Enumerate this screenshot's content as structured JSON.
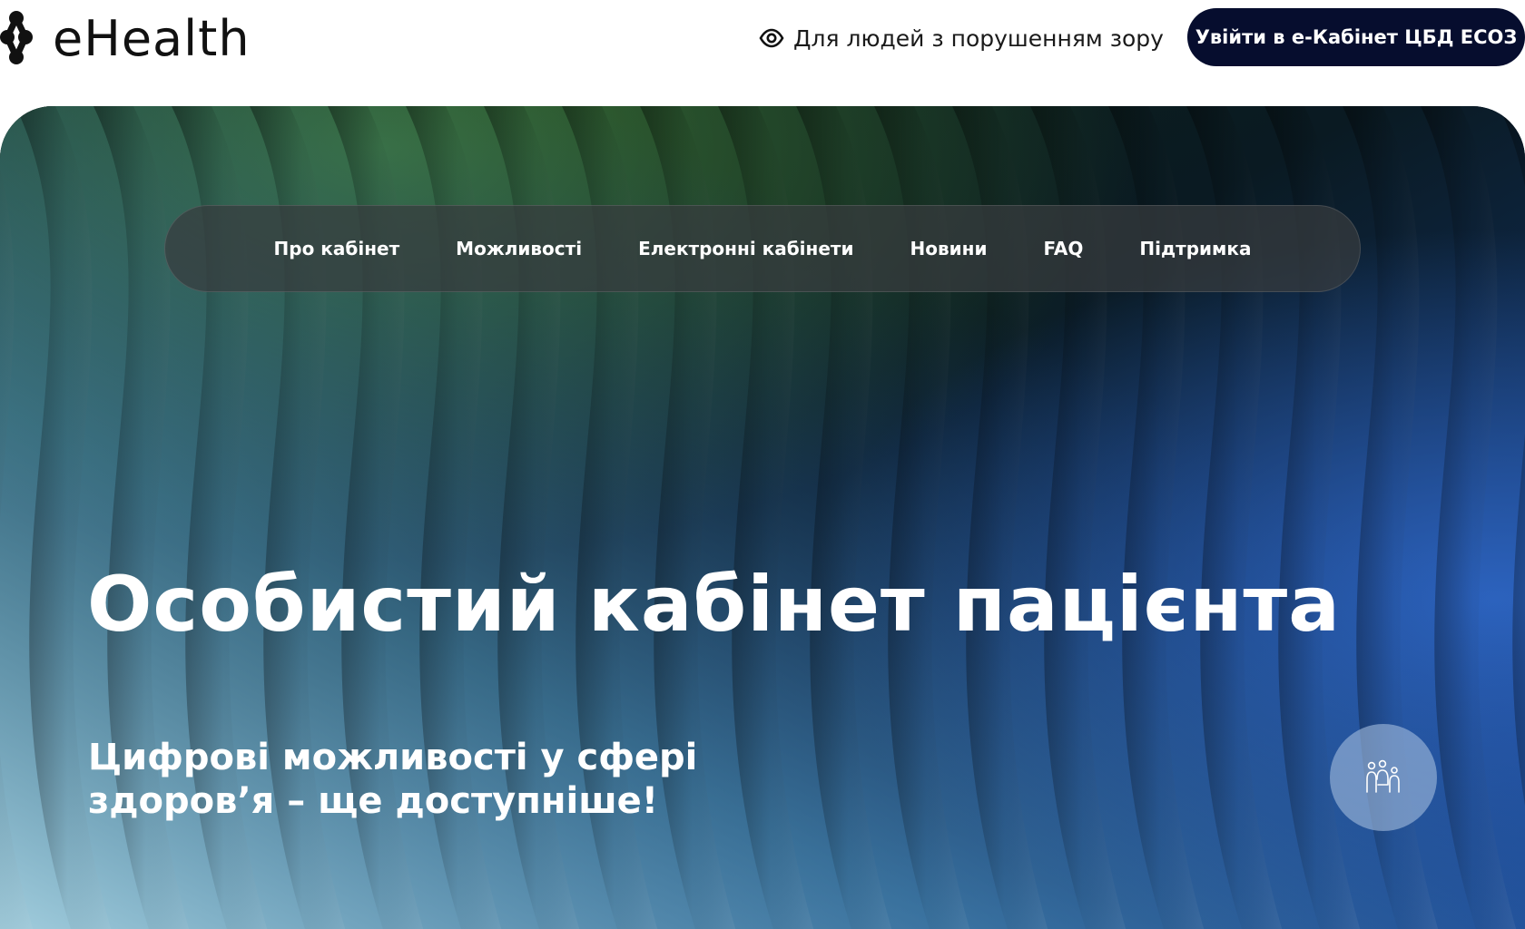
{
  "header": {
    "logo_text": "eHealth",
    "vision_link": "Для людей з порушенням зору",
    "login_button": "Увійти в е-Кабінет ЦБД ЕСОЗ"
  },
  "nav": {
    "items": [
      "Про кабінет",
      "Можливості",
      "Електронні кабінети",
      "Новини",
      "FAQ",
      "Підтримка"
    ]
  },
  "hero": {
    "title": "Особистий кабінет пацієнта",
    "subtitle": "Цифрові можливості у сфері здоров’я – ще доступніше!"
  },
  "icons": {
    "logo": "ehealth-logo-icon",
    "vision": "eye-icon",
    "fab": "family-icon"
  },
  "colors": {
    "login_button": "#060d2e",
    "hero_green": "#3f7a3a",
    "hero_blue": "#2b5fb8",
    "hero_light_blue": "#86c3dc"
  }
}
